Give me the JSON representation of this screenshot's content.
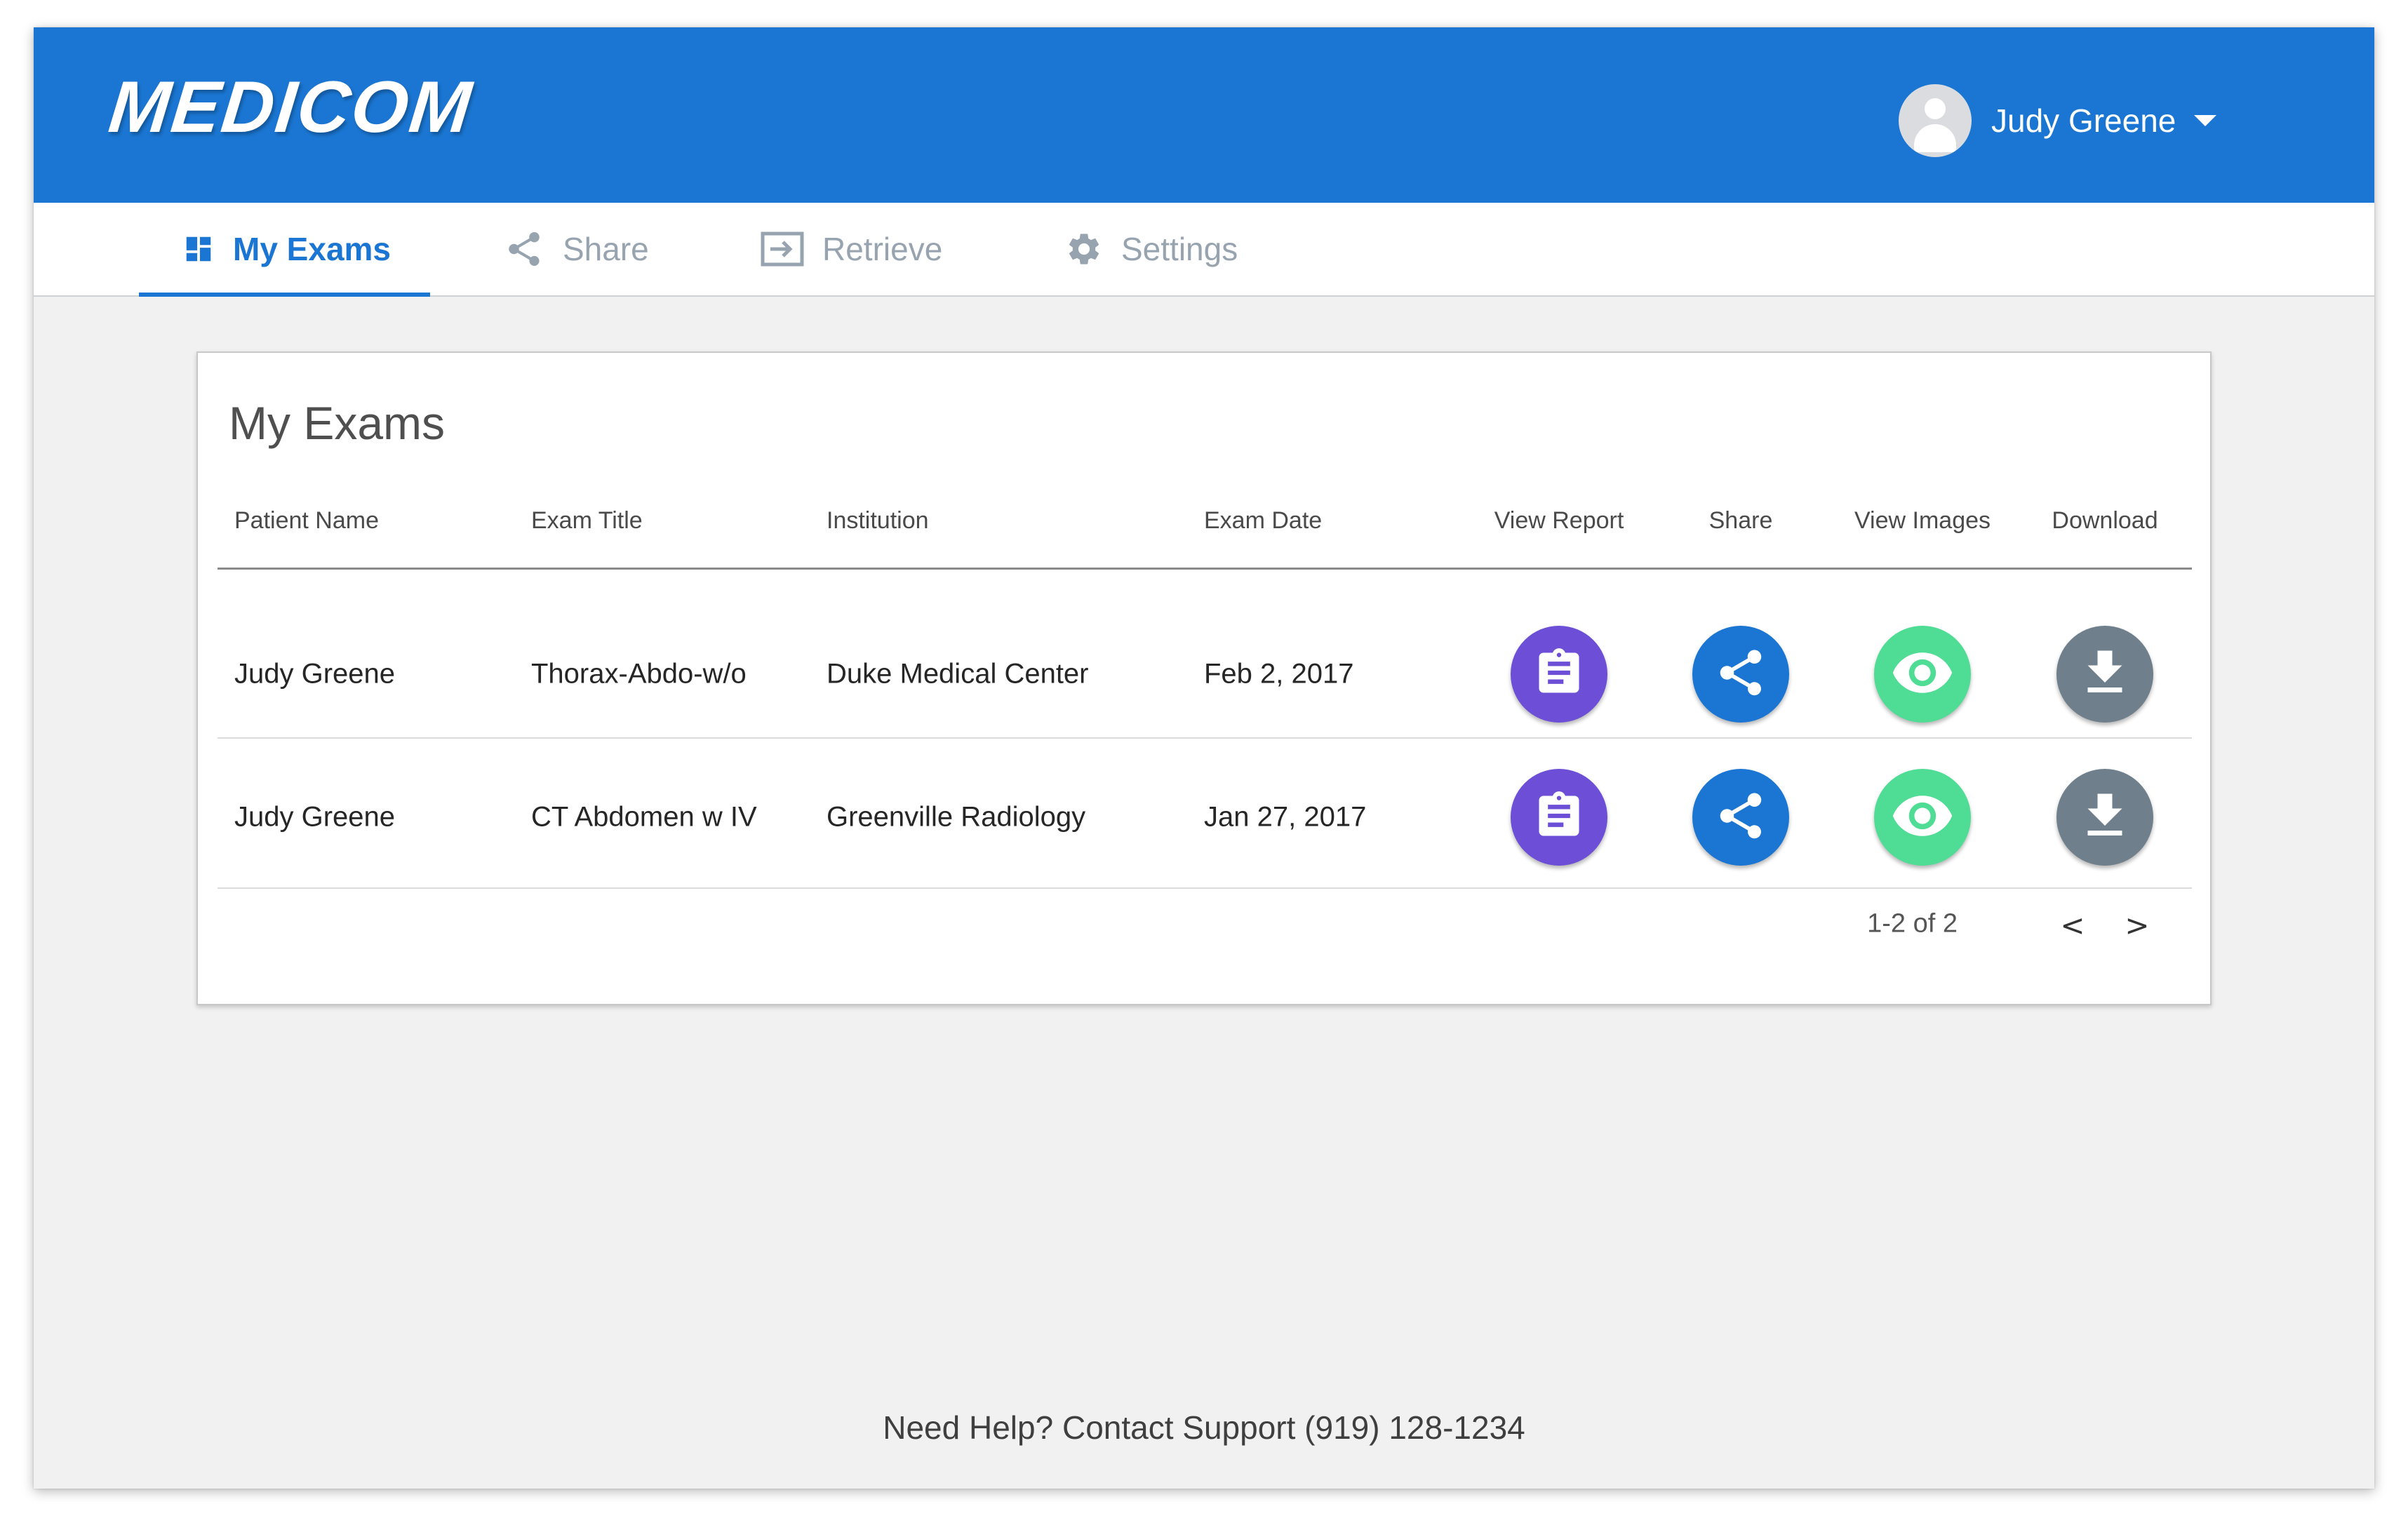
{
  "app": {
    "logo": "MEDICOM",
    "user_name": "Judy Greene"
  },
  "tabs": [
    {
      "label": "My Exams",
      "icon": "dashboard-icon",
      "active": true
    },
    {
      "label": "Share",
      "icon": "share-icon",
      "active": false
    },
    {
      "label": "Retrieve",
      "icon": "login-arrow-icon",
      "active": false
    },
    {
      "label": "Settings",
      "icon": "gear-icon",
      "active": false
    }
  ],
  "exams": {
    "title": "My Exams",
    "columns": [
      "Patient Name",
      "Exam Title",
      "Institution",
      "Exam Date",
      "View Report",
      "Share",
      "View Images",
      "Download"
    ],
    "rows": [
      {
        "patient": "Judy Greene",
        "exam_title": "Thorax-Abdo-w/o",
        "institution": "Duke Medical Center",
        "date": "Feb 2, 2017"
      },
      {
        "patient": "Judy Greene",
        "exam_title": "CT Abdomen w IV",
        "institution": "Greenville Radiology",
        "date": "Jan 27, 2017"
      }
    ],
    "pagination": {
      "label": "1-2 of 2",
      "prev": "<",
      "next": ">"
    }
  },
  "footer": {
    "help_text": "Need Help? Contact Support (919) 128-1234"
  },
  "colors": {
    "brand_blue": "#1a76d2",
    "report_purple": "#6c4fd6",
    "share_blue": "#1a76d2",
    "images_green": "#4fdc94",
    "download_gray": "#6f7f8b"
  }
}
